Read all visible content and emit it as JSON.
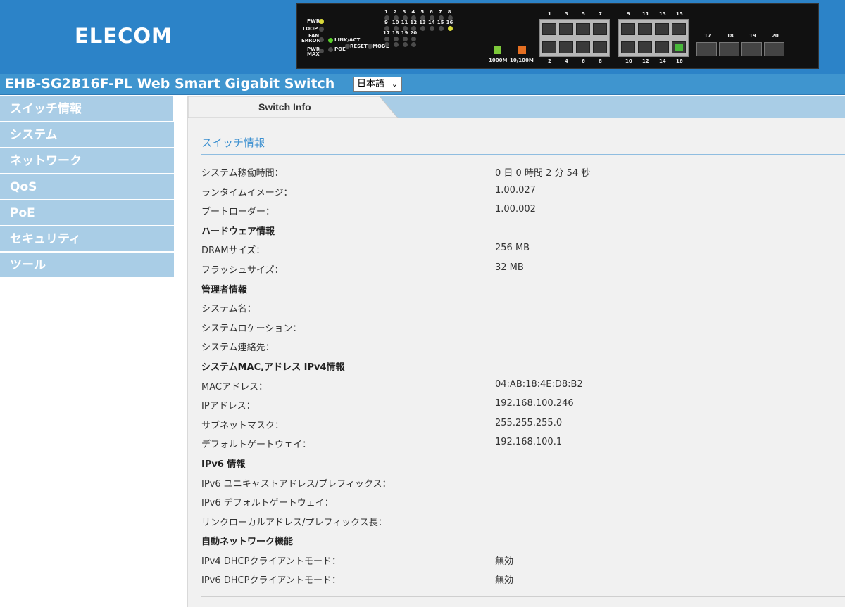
{
  "brand": {
    "logo": "ELECOM"
  },
  "device_panel": {
    "pwr": "PWR",
    "loop": "LOOP",
    "fan_error": [
      "FAN",
      "ERROR"
    ],
    "pwr_max": [
      "PWR",
      "MAX"
    ],
    "link_act": "LINK/ACT",
    "poe": "POE",
    "reset": "RESET",
    "mode": "MODE",
    "led_numbers_row1": [
      "1",
      "2",
      "3",
      "4",
      "5",
      "6",
      "7",
      "8"
    ],
    "led_numbers_row2": [
      "9",
      "10",
      "11",
      "12",
      "13",
      "14",
      "15",
      "16"
    ],
    "led_numbers_row3": [
      "17",
      "18",
      "19",
      "20"
    ],
    "top_ports_a": [
      "1",
      "3",
      "5",
      "7"
    ],
    "bottom_ports_a": [
      "2",
      "4",
      "6",
      "8"
    ],
    "top_ports_b": [
      "9",
      "11",
      "13",
      "15"
    ],
    "bottom_ports_b": [
      "10",
      "12",
      "14",
      "16"
    ],
    "sfp_ports": [
      "17",
      "18",
      "19",
      "20"
    ],
    "speed_1000": "1000M",
    "speed_10_100": "10/100M",
    "speed_1000_color": "#7dc93a",
    "speed_10_100_color": "#e56f22"
  },
  "header": {
    "title": "EHB-SG2B16F-PL Web Smart Gigabit Switch",
    "language_selected": "日本語"
  },
  "sidebar": {
    "items": [
      {
        "label": "スイッチ情報"
      },
      {
        "label": "システム"
      },
      {
        "label": "ネットワーク"
      },
      {
        "label": "QoS"
      },
      {
        "label": "PoE"
      },
      {
        "label": "セキュリティ"
      },
      {
        "label": "ツール"
      }
    ]
  },
  "main": {
    "tab": "Switch Info",
    "section_title": "スイッチ情報",
    "rows": [
      {
        "label": "システム稼働時間：",
        "value": "0 日 0 時間 2 分 54 秒"
      },
      {
        "label": "ランタイムイメージ：",
        "value": "1.00.027"
      },
      {
        "label": "ブートローダー：",
        "value": "1.00.002"
      },
      {
        "label": "ハードウェア情報",
        "value": "",
        "heading": true
      },
      {
        "label": "DRAMサイズ：",
        "value": "256 MB"
      },
      {
        "label": "フラッシュサイズ：",
        "value": "32 MB"
      },
      {
        "label": "管理者情報",
        "value": "",
        "heading": true
      },
      {
        "label": "システム名：",
        "value": ""
      },
      {
        "label": "システムロケーション：",
        "value": ""
      },
      {
        "label": "システム連絡先：",
        "value": ""
      },
      {
        "label": "システムMAC,アドレス IPv4情報",
        "value": "",
        "heading": true
      },
      {
        "label": "MACアドレス：",
        "value": "04:AB:18:4E:D8:B2"
      },
      {
        "label": "IPアドレス：",
        "value": "192.168.100.246"
      },
      {
        "label": "サブネットマスク：",
        "value": "255.255.255.0"
      },
      {
        "label": "デフォルトゲートウェイ：",
        "value": "192.168.100.1"
      },
      {
        "label": "IPv6 情報",
        "value": "",
        "heading": true
      },
      {
        "label": "IPv6 ユニキャストアドレス/プレフィックス：",
        "value": ""
      },
      {
        "label": "IPv6 デフォルトゲートウェイ：",
        "value": ""
      },
      {
        "label": "リンクローカルアドレス/プレフィックス長：",
        "value": ""
      },
      {
        "label": "自動ネットワーク機能",
        "value": "",
        "heading": true
      },
      {
        "label": "IPv4 DHCPクライアントモード：",
        "value": "無効"
      },
      {
        "label": "IPv6 DHCPクライアントモード：",
        "value": "無効"
      }
    ]
  }
}
